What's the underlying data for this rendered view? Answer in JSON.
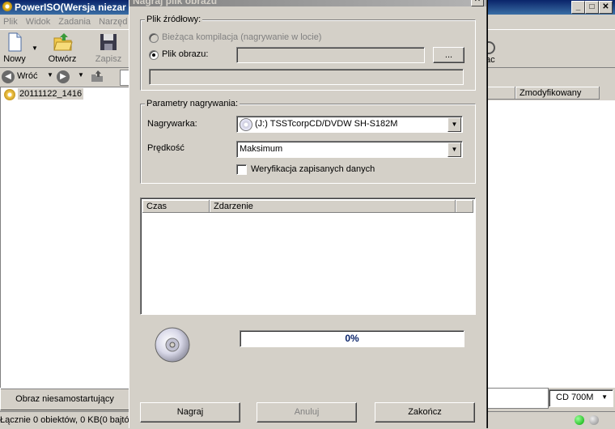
{
  "app": {
    "title": "PowerISO(Wersja niezar"
  },
  "menu": [
    "Plik",
    "Widok",
    "Zadania",
    "Narzęd"
  ],
  "toolbar": {
    "new_label": "Nowy",
    "open_label": "Otwórz",
    "save_label": "Zapisz",
    "partial_label": "ac"
  },
  "nav": {
    "back_label": "Wróć"
  },
  "tree": {
    "items": [
      "20111122_1416"
    ]
  },
  "list": {
    "columns": [
      "Zmodyfikowany"
    ]
  },
  "status": {
    "boot_button": "Obraz niesamostartujący",
    "summary": "Łącznie 0 obiektów, 0 KB(0 bajtó",
    "media_select": "CD 700M"
  },
  "dialog": {
    "title": "Nagraj plik obrazu",
    "source": {
      "legend": "Plik źródłowy:",
      "option_current": "Bieżąca kompilacja (nagrywanie w locie)",
      "option_image": "Plik obrazu:",
      "image_path": "",
      "browse_label": "...",
      "selected": "image"
    },
    "params": {
      "legend": "Parametry nagrywania:",
      "burner_label": "Nagrywarka:",
      "burner_value": "(J:) TSSTcorpCD/DVDW SH-S182M",
      "speed_label": "Prędkość",
      "speed_value": "Maksimum",
      "verify_label": "Weryfikacja zapisanych danych",
      "verify_checked": false
    },
    "log": {
      "columns": [
        "Czas",
        "Zdarzenie"
      ]
    },
    "progress": {
      "percent": 0,
      "text": "0%"
    },
    "buttons": {
      "burn": "Nagraj",
      "cancel": "Anuluj",
      "finish": "Zakończ"
    }
  }
}
